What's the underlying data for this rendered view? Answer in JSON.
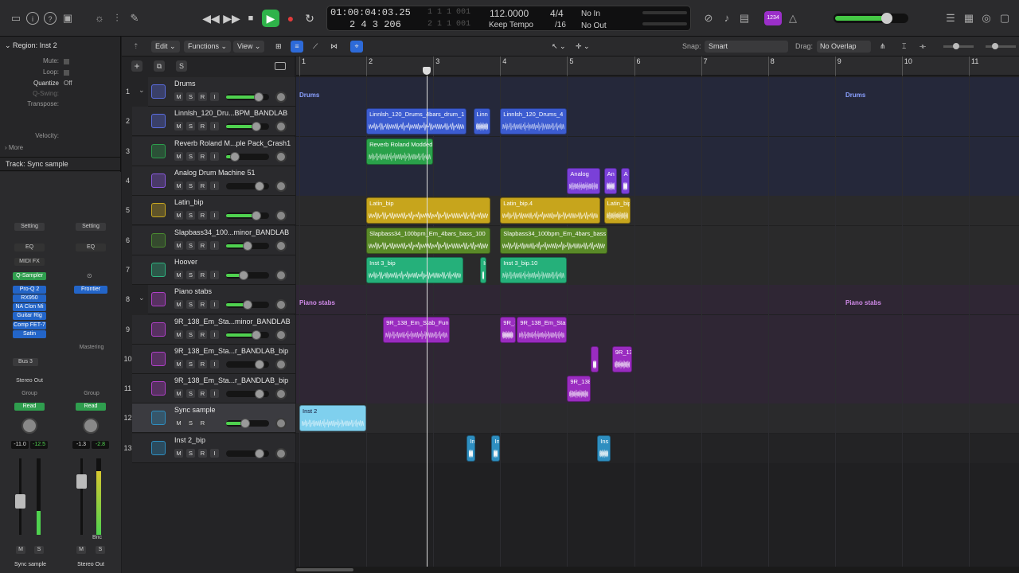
{
  "transport": {
    "position_smpte": "01:00:04:03.25",
    "position_bars": "2  4  3  206",
    "end_smpte": "1  1  1  001",
    "end_bars": "2  1  1  001",
    "tempo": "112.0000",
    "tempo_mode": "Keep Tempo",
    "sig": "4/4",
    "div": "/16",
    "in_label": "No In",
    "out_label": "No Out",
    "midi_count": "1234"
  },
  "inspector": {
    "region_title": "Region: Inst 2",
    "mute": "Mute:",
    "loop": "Loop:",
    "quantize": "Quantize",
    "quantize_val": "Off",
    "qswing": "Q-Swing:",
    "transpose": "Transpose:",
    "velocity": "Velocity:",
    "more": "More",
    "track_title": "Track:  Sync sample",
    "strip_a": {
      "setting": "Setting",
      "eq": "EQ",
      "midifx": "MIDI FX",
      "inst": "Q-Sampler",
      "plugins": [
        "Pro-Q 2",
        "RX950",
        "NA Clon Mi",
        "Guitar Rig",
        "Comp FET-7",
        "Satin"
      ],
      "bus": "Bus 3",
      "out": "Stereo Out",
      "group": "Group",
      "auto": "Read",
      "db": "-11.0",
      "peak": "-12.5",
      "name": "Sync sample"
    },
    "strip_b": {
      "setting": "Setting",
      "eq": "EQ",
      "inst": "Frontier",
      "mastering": "Mastering",
      "group": "Group",
      "auto": "Read",
      "db": "-1.3",
      "peak": "-2.8",
      "bnc": "Bnc",
      "name": "Stereo Out"
    },
    "m": "M",
    "s": "S"
  },
  "toolbar": {
    "edit": "Edit",
    "functions": "Functions",
    "view": "View",
    "snap_label": "Snap:",
    "snap": "Smart",
    "drag_label": "Drag:",
    "drag": "No Overlap"
  },
  "ruler": [
    "1",
    "2",
    "3",
    "4",
    "5",
    "6",
    "7",
    "8",
    "9",
    "10",
    "11"
  ],
  "tracks": [
    {
      "n": "1",
      "name": "Drums",
      "color": "#5a6de0",
      "fill": 75
    },
    {
      "n": "2",
      "name": "Linnlsh_120_Dru...BPM_BANDLAB",
      "color": "#5a6de0",
      "fill": 70
    },
    {
      "n": "3",
      "name": "Reverb Roland M...ple Pack_Crash1",
      "color": "#2c9e4c",
      "fill": 20
    },
    {
      "n": "4",
      "name": "Analog Drum Machine 51",
      "color": "#8a5ae0",
      "fill": 0
    },
    {
      "n": "5",
      "name": "Latin_bip",
      "color": "#c9a820",
      "fill": 70
    },
    {
      "n": "6",
      "name": "Slapbass34_100...minor_BANDLAB",
      "color": "#4a8a30",
      "fill": 50
    },
    {
      "n": "7",
      "name": "Hoover",
      "color": "#2fb380",
      "fill": 40
    },
    {
      "n": "8",
      "name": "Piano stabs",
      "color": "#b040c8",
      "fill": 50
    },
    {
      "n": "9",
      "name": "9R_138_Em_Sta...minor_BANDLAB",
      "color": "#b040c8",
      "fill": 70
    },
    {
      "n": "10",
      "name": "9R_138_Em_Sta...r_BANDLAB_bip",
      "color": "#b040c8",
      "fill": 0
    },
    {
      "n": "11",
      "name": "9R_138_Em_Sta...r_BANDLAB_bip",
      "color": "#b040c8",
      "fill": 0
    },
    {
      "n": "12",
      "name": "Sync sample",
      "color": "#2e8ec0",
      "fill": 45
    },
    {
      "n": "13",
      "name": "Inst 2_bip",
      "color": "#2e8ec0",
      "fill": 0
    }
  ],
  "group_labels": {
    "drums": "Drums",
    "piano": "Piano stabs"
  },
  "regions": [
    {
      "t": 0,
      "l": "Linnlsh_120_Drums_4bars_drum_1",
      "s": 1,
      "e": 2.5,
      "c": "#3c5cd0"
    },
    {
      "t": 0,
      "l": "Linn",
      "s": 2.6,
      "e": 2.85,
      "c": "#3c5cd0"
    },
    {
      "t": 0,
      "l": "Linnlsh_120_Drums_4",
      "s": 3,
      "e": 4,
      "c": "#3c5cd0"
    },
    {
      "t": 1,
      "l": "Reverb Roland Modded",
      "s": 1,
      "e": 2,
      "c": "#2aa14a"
    },
    {
      "t": 2,
      "l": "Analog",
      "s": 4,
      "e": 4.5,
      "c": "#7a40d8"
    },
    {
      "t": 2,
      "l": "An",
      "s": 4.55,
      "e": 4.75,
      "c": "#7a40d8"
    },
    {
      "t": 2,
      "l": "A",
      "s": 4.8,
      "e": 4.93,
      "c": "#7a40d8"
    },
    {
      "t": 3,
      "l": "Latin_bip",
      "s": 1,
      "e": 2.85,
      "c": "#c7a51c"
    },
    {
      "t": 3,
      "l": "Latin_bip.4",
      "s": 3,
      "e": 4.5,
      "c": "#c7a51c"
    },
    {
      "t": 3,
      "l": "Latin_bip",
      "s": 4.55,
      "e": 4.95,
      "c": "#c7a51c"
    },
    {
      "t": 4,
      "l": "Slapbass34_100bpm_Em_4bars_bass_100",
      "s": 1,
      "e": 2.85,
      "c": "#5a8a28"
    },
    {
      "t": 4,
      "l": "Slapbass34_100bpm_Em_4bars_bass",
      "s": 3,
      "e": 4.6,
      "c": "#5a8a28"
    },
    {
      "t": 5,
      "l": "Inst 3_bip",
      "s": 1,
      "e": 2.45,
      "c": "#25b07a"
    },
    {
      "t": 5,
      "l": "In",
      "s": 2.7,
      "e": 2.8,
      "c": "#25b07a"
    },
    {
      "t": 5,
      "l": "Inst 3_bip.10",
      "s": 3,
      "e": 4,
      "c": "#25b07a"
    },
    {
      "t": 7,
      "l": "9R_138_Em_Stab_Fun",
      "s": 1.25,
      "e": 2.25,
      "c": "#9a2cc0"
    },
    {
      "t": 7,
      "l": "9R_1",
      "s": 3,
      "e": 3.23,
      "c": "#9a2cc0"
    },
    {
      "t": 7,
      "l": "9R_138_Em_Sta",
      "s": 3.25,
      "e": 4,
      "c": "#9a2cc0"
    },
    {
      "t": 8,
      "l": "",
      "s": 4.35,
      "e": 4.47,
      "c": "#9a2cc0"
    },
    {
      "t": 8,
      "l": "9R_13",
      "s": 4.67,
      "e": 4.97,
      "c": "#9a2cc0"
    },
    {
      "t": 9,
      "l": "9R_138",
      "s": 4,
      "e": 4.35,
      "c": "#9a2cc0"
    },
    {
      "t": 10,
      "l": "Inst 2",
      "s": 0,
      "e": 1,
      "c": "#7fd0ee"
    },
    {
      "t": 11,
      "l": "In",
      "s": 2.5,
      "e": 2.63,
      "c": "#2e8ec0"
    },
    {
      "t": 11,
      "l": "In",
      "s": 2.87,
      "e": 3,
      "c": "#2e8ec0"
    },
    {
      "t": 11,
      "l": "Ins",
      "s": 4.45,
      "e": 4.65,
      "c": "#2e8ec0"
    }
  ],
  "playhead_bar": 2.9,
  "colors": {
    "accent": "#2fb34a",
    "record": "#e23b3b",
    "blue": "#2365c8"
  }
}
